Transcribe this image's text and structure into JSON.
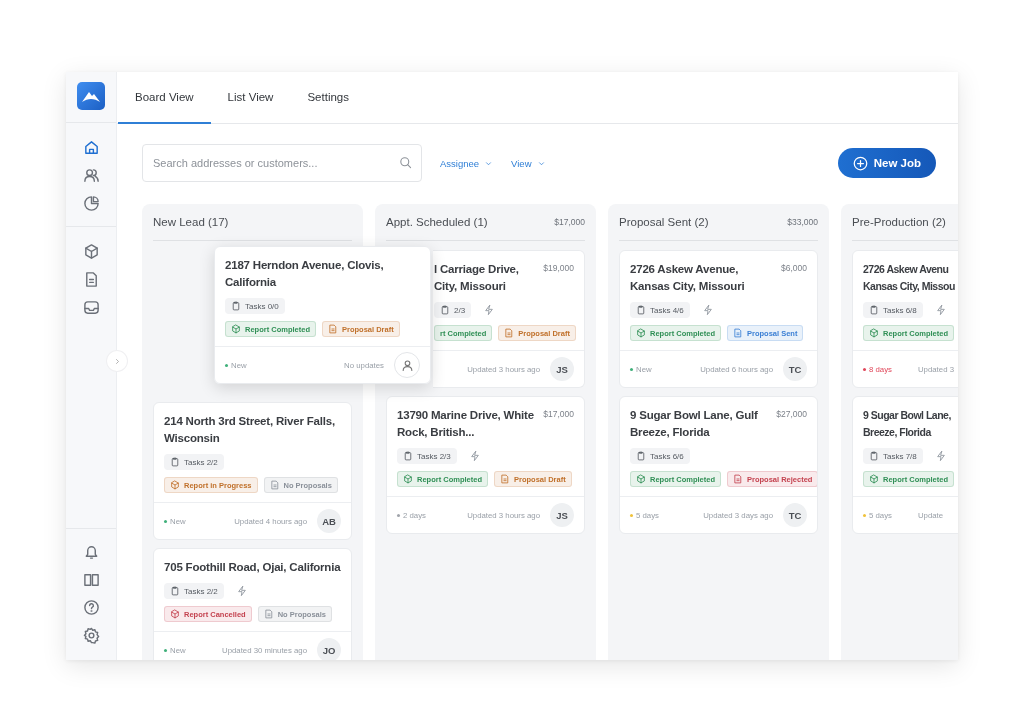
{
  "sidebar": {
    "main_icons": [
      {
        "selected": true
      },
      {
        "selected": false
      },
      {
        "selected": false
      }
    ],
    "tool_icons": [
      {
        "selected": false
      },
      {
        "selected": false
      },
      {
        "selected": false
      }
    ],
    "footer_icons": [
      {
        "selected": false
      },
      {
        "selected": false
      },
      {
        "selected": false
      },
      {
        "selected": false
      }
    ]
  },
  "tabs": [
    {
      "label": "Board View",
      "selected": true
    },
    {
      "label": "List View",
      "selected": false
    },
    {
      "label": "Settings",
      "selected": false
    }
  ],
  "search": {
    "placeholder": "Search addresses or customers..."
  },
  "filters": [
    "Assignee",
    "View"
  ],
  "new_job_button": "New Job",
  "columns": [
    {
      "title": "New Lead (17)",
      "drag_placeholder": true,
      "cards": [
        {
          "title_lines": [
            "214 North 3rd Street, River Falls,",
            "Wisconsin"
          ],
          "tasks": "Tasks 2/2",
          "bolt": false,
          "tags": [
            {
              "label": "Report in Progress",
              "kind": "report",
              "color": "#c0702a"
            },
            {
              "label": "No Proposals",
              "kind": "proposal",
              "color": "#8a9099"
            }
          ],
          "status": {
            "label": "New",
            "color": "#3fb07a"
          },
          "updated": "Updated 4 hours ago",
          "avatar": {
            "kind": "initials",
            "text": "AB"
          }
        },
        {
          "title_lines": [
            "705 Foothill Road, Ojai, California"
          ],
          "tasks": "Tasks 2/2",
          "bolt": true,
          "tags": [
            {
              "label": "Report Cancelled",
              "kind": "report",
              "color": "#c4424f"
            },
            {
              "label": "No Proposals",
              "kind": "proposal",
              "color": "#8a9099"
            }
          ],
          "status": {
            "label": "New",
            "color": "#3fb07a"
          },
          "updated": "Updated 30 minutes ago",
          "avatar": {
            "kind": "initials",
            "text": "JO"
          }
        }
      ]
    },
    {
      "title": "Appt. Scheduled (1)",
      "total": "$17,000",
      "cards": [
        {
          "covered": true,
          "title_lines": [
            "l Carriage Drive,",
            "City, Missouri"
          ],
          "amount": "$19,000",
          "tasks": "2/3",
          "bolt": true,
          "tags": [
            {
              "label": "rt Completed",
              "color": "#2f8f55"
            },
            {
              "label": "Proposal Draft",
              "kind": "proposal",
              "color": "#c0702a"
            }
          ],
          "updated": "Updated 3 hours ago",
          "avatar": {
            "kind": "initials",
            "text": "JS"
          }
        },
        {
          "title_lines": [
            "13790 Marine Drive, White",
            "Rock, British..."
          ],
          "amount": "$17,000",
          "tasks": "Tasks 2/3",
          "bolt": true,
          "tags": [
            {
              "label": "Report Completed",
              "kind": "report",
              "color": "#2f8f55"
            },
            {
              "label": "Proposal Draft",
              "kind": "proposal",
              "color": "#c0702a"
            }
          ],
          "status": {
            "label": "2 days",
            "color": "#a0a4ab"
          },
          "updated": "Updated 3 hours ago",
          "avatar": {
            "kind": "initials",
            "text": "JS"
          }
        }
      ]
    },
    {
      "title": "Proposal Sent (2)",
      "total": "$33,000",
      "cards": [
        {
          "title_lines": [
            "2726 Askew Avenue,",
            "Kansas City, Missouri"
          ],
          "amount": "$6,000",
          "tasks": "Tasks 4/6",
          "bolt": true,
          "tags": [
            {
              "label": "Report Completed",
              "kind": "report",
              "color": "#2f8f55"
            },
            {
              "label": "Proposal Sent",
              "kind": "proposal",
              "color": "#3b7fd4"
            }
          ],
          "status": {
            "label": "New",
            "color": "#3fb07a"
          },
          "updated": "Updated 6 hours ago",
          "avatar": {
            "kind": "initials",
            "text": "TC"
          }
        },
        {
          "title_lines": [
            "9 Sugar Bowl Lane, Gulf",
            "Breeze, Florida"
          ],
          "amount": "$27,000",
          "tasks": "Tasks 6/6",
          "bolt": false,
          "tags": [
            {
              "label": "Report Completed",
              "kind": "report",
              "color": "#2f8f55"
            },
            {
              "label": "Proposal Rejected",
              "kind": "proposal",
              "color": "#c4424f"
            }
          ],
          "status": {
            "label": "5 days",
            "color": "#f0c23b"
          },
          "updated": "Updated 3 days ago",
          "avatar": {
            "kind": "initials",
            "text": "TC"
          }
        }
      ]
    },
    {
      "title": "Pre-Production (2)",
      "cut": true,
      "cards": [
        {
          "title_lines": [
            "2726 Askew Avenu",
            "Kansas City, Missou"
          ],
          "tasks": "Tasks 6/8",
          "bolt": true,
          "tags": [
            {
              "label": "Report Completed",
              "kind": "report",
              "color": "#2f8f55"
            }
          ],
          "status": {
            "label": "8 days",
            "color": "#e0475a",
            "alert": true
          },
          "updated": "Updated 3",
          "avatar": {
            "kind": "none"
          }
        },
        {
          "title_lines": [
            "9 Sugar Bowl Lane,",
            "Breeze, Florida"
          ],
          "tasks": "Tasks 7/8",
          "bolt": true,
          "tags": [
            {
              "label": "Report Completed",
              "kind": "report",
              "color": "#2f8f55"
            }
          ],
          "status": {
            "label": "5 days",
            "color": "#f0c23b"
          },
          "updated": "Update",
          "avatar": {
            "kind": "none"
          }
        }
      ]
    }
  ],
  "dragged_card": {
    "title_lines": [
      "2187 Herndon Avenue, Clovis,",
      "California"
    ],
    "tasks": "Tasks 0/0",
    "bolt": false,
    "tags": [
      {
        "label": "Report Completed",
        "kind": "report",
        "color": "#2f8f55"
      },
      {
        "label": "Proposal Draft",
        "kind": "proposal",
        "color": "#c0702a"
      }
    ],
    "status": {
      "label": "New",
      "color": "#3fb07a"
    },
    "updated": "No updates",
    "avatar": {
      "kind": "empty"
    }
  }
}
